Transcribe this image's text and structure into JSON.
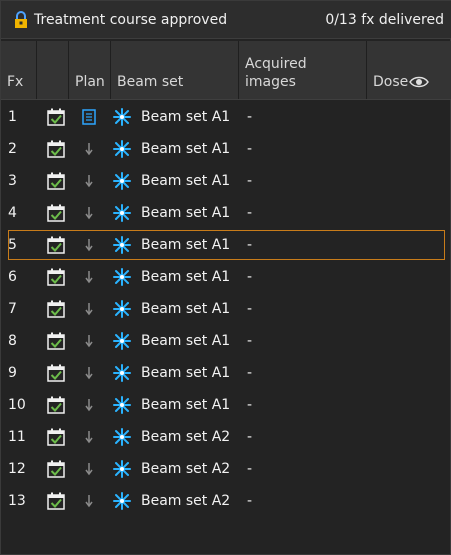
{
  "header_bar": {
    "title": "Treatment course approved",
    "fx_status": "0/13 fx delivered",
    "lock_icon": "lock-icon"
  },
  "columns": {
    "fx": "Fx",
    "check": "",
    "plan": "Plan",
    "beam_set": "Beam set",
    "acquired_images": [
      "Acquired",
      "images"
    ],
    "dose": "Dose",
    "dose_icon": "eye-icon"
  },
  "rows": [
    {
      "fx": "1",
      "plan": "document-icon",
      "beam_set": "Beam set A1",
      "acquired": "-"
    },
    {
      "fx": "2",
      "plan": "arrow-down-icon",
      "beam_set": "Beam set A1",
      "acquired": "-"
    },
    {
      "fx": "3",
      "plan": "arrow-down-icon",
      "beam_set": "Beam set A1",
      "acquired": "-"
    },
    {
      "fx": "4",
      "plan": "arrow-down-icon",
      "beam_set": "Beam set A1",
      "acquired": "-"
    },
    {
      "fx": "5",
      "plan": "arrow-down-icon",
      "beam_set": "Beam set A1",
      "acquired": "-",
      "selected": true
    },
    {
      "fx": "6",
      "plan": "arrow-down-icon",
      "beam_set": "Beam set A1",
      "acquired": "-"
    },
    {
      "fx": "7",
      "plan": "arrow-down-icon",
      "beam_set": "Beam set A1",
      "acquired": "-"
    },
    {
      "fx": "8",
      "plan": "arrow-down-icon",
      "beam_set": "Beam set A1",
      "acquired": "-"
    },
    {
      "fx": "9",
      "plan": "arrow-down-icon",
      "beam_set": "Beam set A1",
      "acquired": "-"
    },
    {
      "fx": "10",
      "plan": "arrow-down-icon",
      "beam_set": "Beam set A1",
      "acquired": "-"
    },
    {
      "fx": "11",
      "plan": "arrow-down-icon",
      "beam_set": "Beam set A2",
      "acquired": "-"
    },
    {
      "fx": "12",
      "plan": "arrow-down-icon",
      "beam_set": "Beam set A2",
      "acquired": "-"
    },
    {
      "fx": "13",
      "plan": "arrow-down-icon",
      "beam_set": "Beam set A2",
      "acquired": "-"
    }
  ],
  "colors": {
    "accent_yellow": "#f0b400",
    "check_green": "#6cbb4a",
    "plan_blue": "#2da6ff",
    "selection_orange": "#c87c1a"
  }
}
